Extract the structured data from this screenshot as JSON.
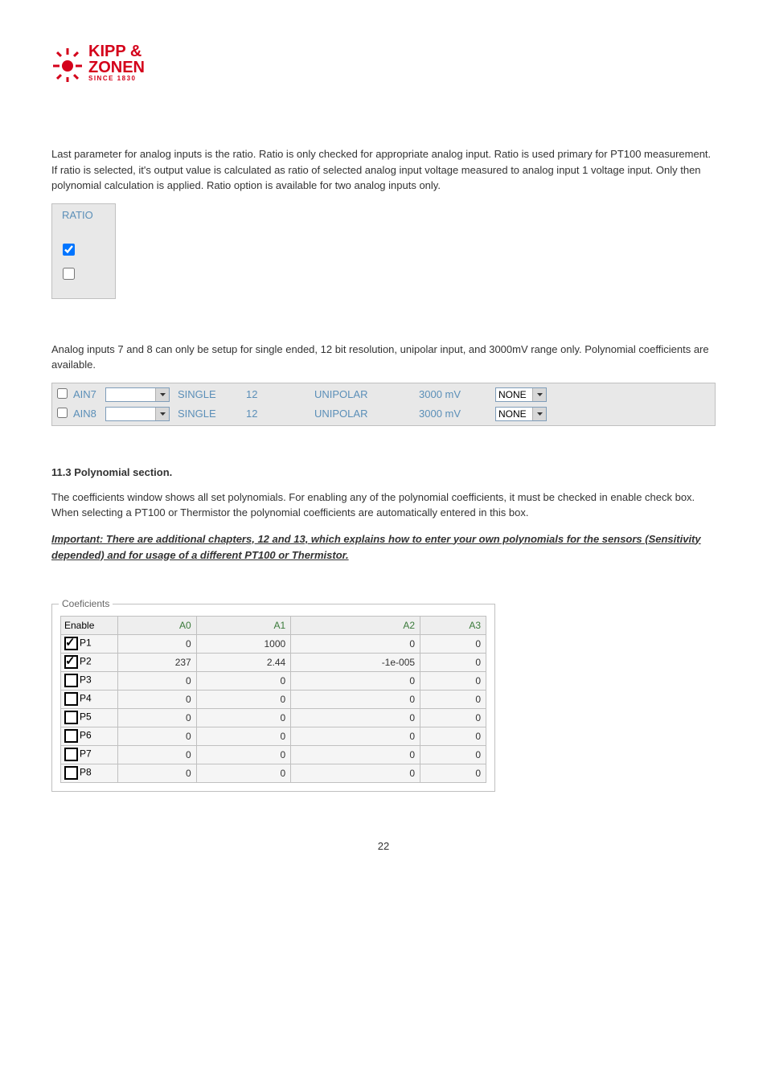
{
  "logo": {
    "line1": "KIPP &",
    "line2": "ZONEN",
    "line3": "SINCE 1830"
  },
  "paragraph1": "Last parameter for analog inputs is the ratio. Ratio is only checked for appropriate analog input. Ratio is used primary for PT100 measurement. If ratio is selected, it's output value is calculated as ratio of selected analog input voltage measured to analog input 1 voltage input. Only then polynomial calculation is applied. Ratio option is available for two analog inputs only.",
  "ratio": {
    "title": "RATIO",
    "items": [
      {
        "checked": true
      },
      {
        "checked": false
      }
    ]
  },
  "paragraph2": "Analog inputs 7 and 8 can only be setup for single ended, 12 bit resolution, unipolar input, and 3000mV range only. Polynomial coefficients are available.",
  "ain_rows": [
    {
      "enabled": false,
      "label": "AIN7",
      "type": "SINGLE",
      "bits": "12",
      "polar": "UNIPOLAR",
      "range": "3000 mV",
      "none": "NONE"
    },
    {
      "enabled": false,
      "label": "AIN8",
      "type": "SINGLE",
      "bits": "12",
      "polar": "UNIPOLAR",
      "range": "3000 mV",
      "none": "NONE"
    }
  ],
  "section_heading": "11.3   Polynomial section.",
  "paragraph3": "The coefficients window shows all set polynomials. For enabling any of the polynomial coefficients, it must be checked in enable check box. When selecting a PT100 or Thermistor the polynomial coefficients are automatically entered in this box.",
  "important": "Important: There are additional chapters, 12 and 13, which explains how to enter your own polynomials for the sensors (Sensitivity depended) and for usage of a different PT100 or Thermistor.",
  "coefficients": {
    "title": "Coeficients",
    "headers": [
      "Enable",
      "A0",
      "A1",
      "A2",
      "A3"
    ],
    "rows": [
      {
        "checked": true,
        "label": "P1",
        "a0": "0",
        "a1": "1000",
        "a2": "0",
        "a3": "0"
      },
      {
        "checked": true,
        "label": "P2",
        "a0": "237",
        "a1": "2.44",
        "a2": "-1e-005",
        "a3": "0"
      },
      {
        "checked": false,
        "label": "P3",
        "a0": "0",
        "a1": "0",
        "a2": "0",
        "a3": "0"
      },
      {
        "checked": false,
        "label": "P4",
        "a0": "0",
        "a1": "0",
        "a2": "0",
        "a3": "0"
      },
      {
        "checked": false,
        "label": "P5",
        "a0": "0",
        "a1": "0",
        "a2": "0",
        "a3": "0"
      },
      {
        "checked": false,
        "label": "P6",
        "a0": "0",
        "a1": "0",
        "a2": "0",
        "a3": "0"
      },
      {
        "checked": false,
        "label": "P7",
        "a0": "0",
        "a1": "0",
        "a2": "0",
        "a3": "0"
      },
      {
        "checked": false,
        "label": "P8",
        "a0": "0",
        "a1": "0",
        "a2": "0",
        "a3": "0"
      }
    ]
  },
  "page_number": "22"
}
